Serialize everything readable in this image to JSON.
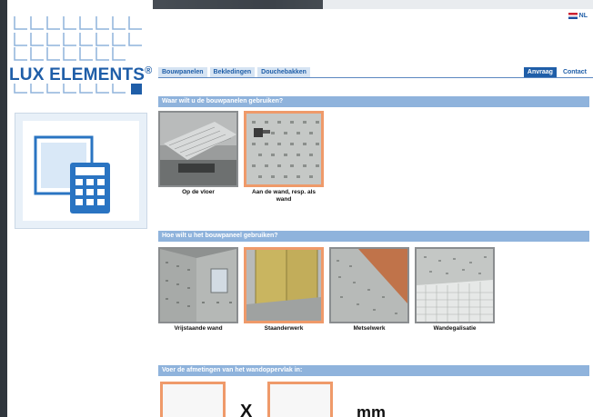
{
  "logo": {
    "brand": "LUX ELEMENTS",
    "reg": "®"
  },
  "language": {
    "label": "NL"
  },
  "nav": {
    "items": [
      "Bouwpanelen",
      "Bekledingen",
      "Douchebakken"
    ],
    "request": "Anvraag",
    "contact": "Contact"
  },
  "section1": {
    "title": "Waar wilt u de bouwpanelen gebruiken?",
    "options": [
      {
        "label": "Op de vloer",
        "selected": false
      },
      {
        "label": "Aan de wand, resp. als wand",
        "selected": true
      }
    ]
  },
  "section2": {
    "title": "Hoe wilt u het bouwpaneel gebruiken?",
    "options": [
      {
        "label": "Vrijstaande wand",
        "selected": false
      },
      {
        "label": "Staanderwerk",
        "selected": true
      },
      {
        "label": "Metselwerk",
        "selected": false
      },
      {
        "label": "Wandegalisatie",
        "selected": false
      }
    ]
  },
  "section3": {
    "title": "Voer de afmetingen van het wandoppervlak in:",
    "separator": "X",
    "unit": "mm"
  },
  "colors": {
    "brand_blue": "#1f5ea8",
    "section_bar": "#8fb3dc",
    "selected_border": "#ef9a6a"
  }
}
